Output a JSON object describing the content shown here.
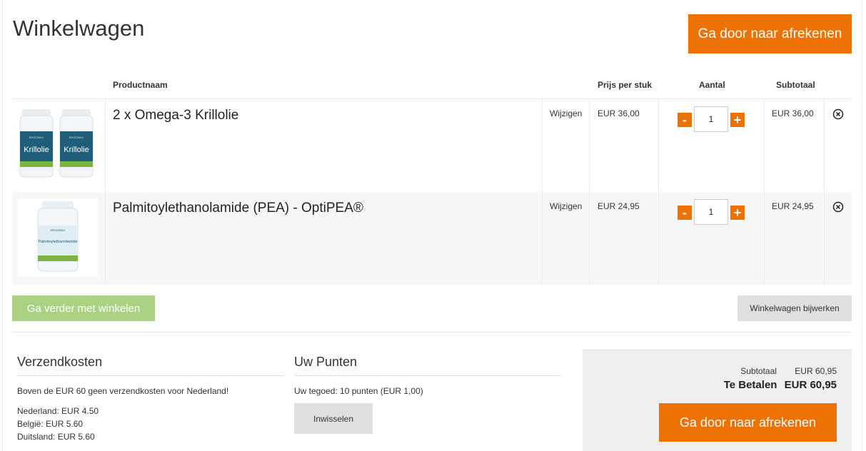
{
  "page": {
    "title": "Winkelwagen",
    "checkout_label": "Ga door naar afrekenen"
  },
  "table": {
    "headers": {
      "product": "Productnaam",
      "price": "Prijs per stuk",
      "quantity": "Aantal",
      "subtotal": "Subtotaal"
    },
    "items": [
      {
        "name": "2 x Omega-3 Krillolie",
        "edit_label": "Wijzigen",
        "price": "EUR  36,00",
        "qty": "1",
        "subtotal": "EUR  36,00",
        "image_text": "Krillolie"
      },
      {
        "name": "Palmitoylethanolamide (PEA) - OptiPEA®",
        "edit_label": "Wijzigen",
        "price": "EUR  24,95",
        "qty": "1",
        "subtotal": "EUR  24,95",
        "image_text": "Palmitoylethanolamide"
      }
    ],
    "minus_label": "-",
    "plus_label": "+"
  },
  "actions": {
    "continue_label": "Ga verder met winkelen",
    "update_label": "Winkelwagen bijwerken"
  },
  "shipping": {
    "title": "Verzendkosten",
    "note": "Boven de EUR 60 geen verzendkosten voor Nederland!",
    "rates": [
      "Nederland: EUR 4.50",
      "België: EUR 5.60",
      "Duitsland: EUR 5.60"
    ]
  },
  "points": {
    "title": "Uw Punten",
    "balance": "Uw tegoed: 10 punten (EUR  1,00)",
    "redeem_label": "Inwisselen"
  },
  "totals": {
    "subtotal_label": "Subtotaal",
    "subtotal_value": "EUR  60,95",
    "pay_label": "Te Betalen",
    "pay_value": "EUR  60,95"
  },
  "colors": {
    "accent": "#ee7203",
    "continue": "#aad282",
    "neutral_button": "#e0e0e0"
  },
  "icons": {
    "remove": "circle-x-icon"
  }
}
